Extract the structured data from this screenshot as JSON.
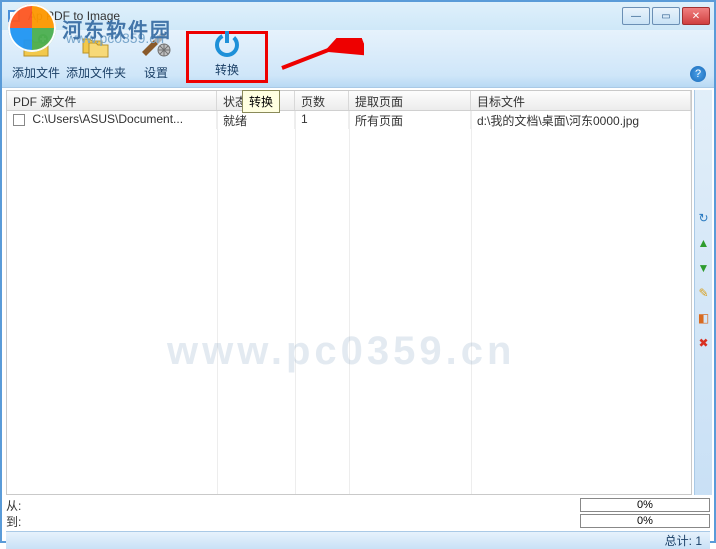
{
  "window": {
    "title": "Ap PDF to Image"
  },
  "watermark": {
    "site_name": "河东软件园",
    "site_url": "www.pc0359.cn"
  },
  "toolbar": {
    "add_file": "添加文件",
    "add_folder": "添加文件夹",
    "settings": "设置",
    "convert": "转换",
    "help": "?"
  },
  "tooltip": {
    "convert": "转换"
  },
  "grid": {
    "columns": {
      "source": "PDF 源文件",
      "status": "状态",
      "pages": "页数",
      "extract": "提取页面",
      "target": "目标文件"
    },
    "rows": [
      {
        "source": "C:\\Users\\ASUS\\Document...",
        "status": "就绪",
        "pages": "1",
        "extract": "所有页面",
        "target": "d:\\我的文档\\桌面\\河东0000.jpg"
      }
    ]
  },
  "progress": {
    "from_label": "从:",
    "to_label": "到:",
    "from_pct": "0%",
    "to_pct": "0%"
  },
  "footer": {
    "total_label": "总计: 1"
  }
}
